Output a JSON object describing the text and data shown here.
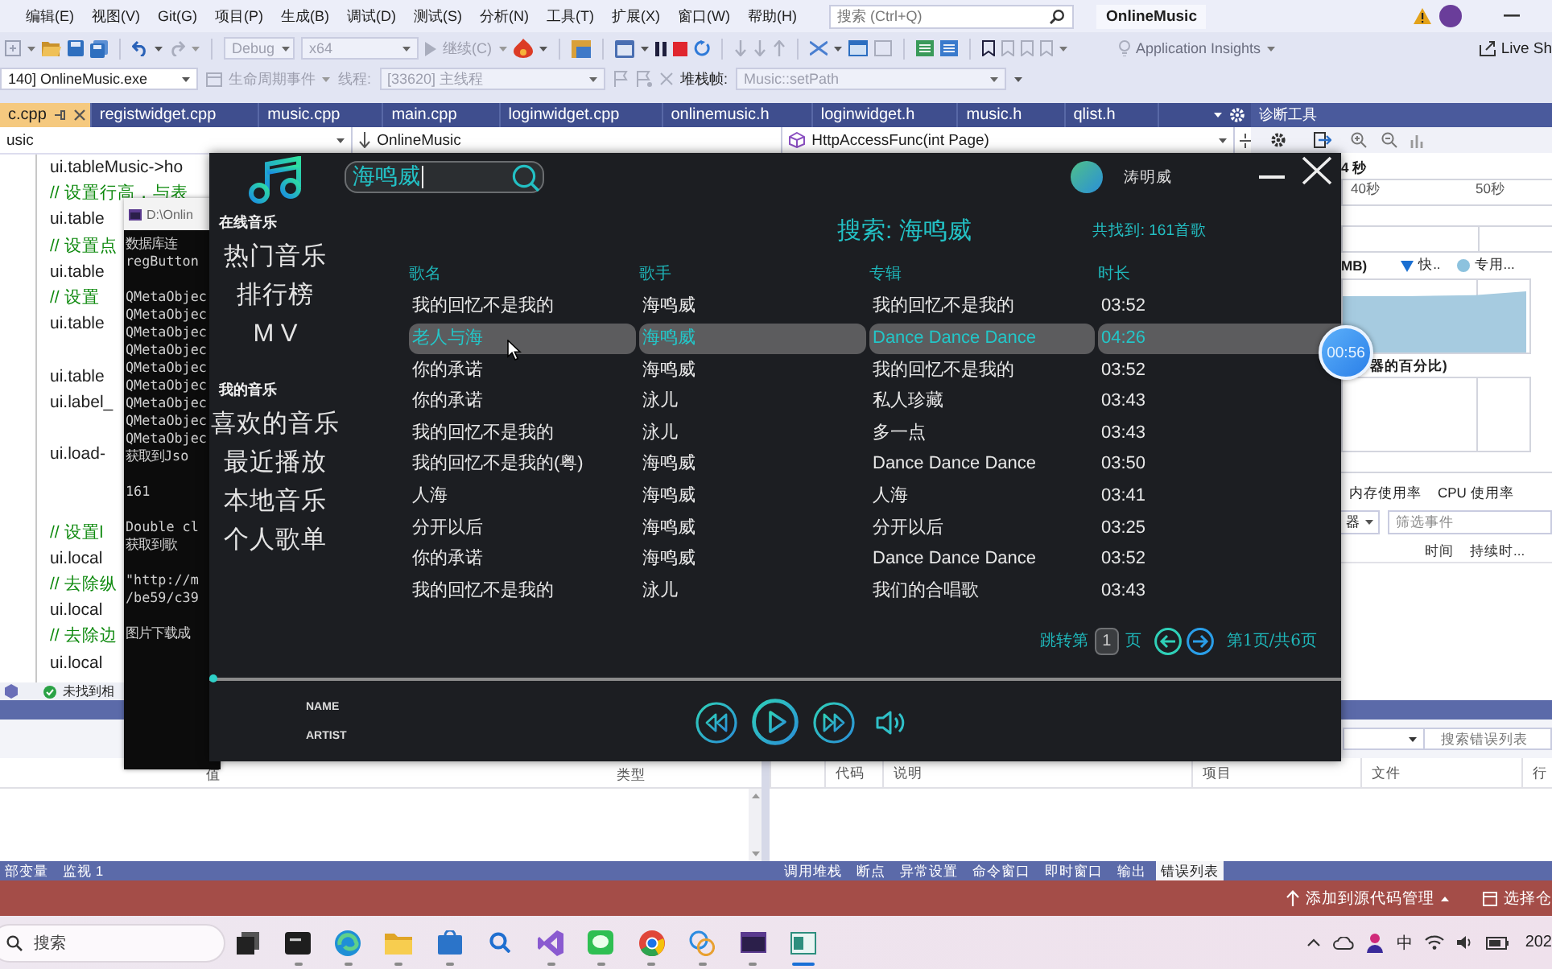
{
  "vs": {
    "menu": [
      "编辑(E)",
      "视图(V)",
      "Git(G)",
      "项目(P)",
      "生成(B)",
      "调试(D)",
      "测试(S)",
      "分析(N)",
      "工具(T)",
      "扩展(X)",
      "窗口(W)",
      "帮助(H)"
    ],
    "search": {
      "placeholder": "搜索 (Ctrl+Q)"
    },
    "solution": "OnlineMusic",
    "toolbar": {
      "configuration": {
        "label": "Debug",
        "disabled": true
      },
      "platform": {
        "label": "x64",
        "disabled": true
      },
      "continue": {
        "label": "继续(C)",
        "disabled": true
      },
      "insights": "Application Insights",
      "live_share": "Live Sh"
    },
    "debug_bar": {
      "process": "140] OnlineMusic.exe",
      "lifecycle": {
        "label": "生命周期事件",
        "disabled": true
      },
      "thread_label": "线程:",
      "thread": {
        "label": "[33620] 主线程",
        "disabled": true
      },
      "stack_label": "堆栈帧:",
      "stack_frame": {
        "label": "Music::setPath",
        "disabled": true
      }
    },
    "tabs": [
      {
        "label": "c.cpp",
        "selected": true
      },
      {
        "label": "registwidget.cpp",
        "selected": false
      },
      {
        "label": "music.cpp",
        "selected": false
      },
      {
        "label": "main.cpp",
        "selected": false
      },
      {
        "label": "loginwidget.cpp",
        "selected": false
      },
      {
        "label": "onlinemusic.h",
        "selected": false
      },
      {
        "label": "loginwidget.h",
        "selected": false
      },
      {
        "label": "music.h",
        "selected": false
      },
      {
        "label": "qlist.h",
        "selected": false
      }
    ],
    "nav_bar": {
      "scope": "usic",
      "type": "OnlineMusic",
      "member": "HttpAccessFunc(int Page)"
    },
    "code_lines": [
      {
        "kind": "code",
        "text": "ui.tableMusic->ho"
      },
      {
        "kind": "comment",
        "text": "// 设置行高，与表"
      },
      {
        "kind": "code",
        "text": "ui.table"
      },
      {
        "kind": "comment",
        "text": "// 设置点"
      },
      {
        "kind": "code",
        "text": "ui.table"
      },
      {
        "kind": "comment",
        "text": "//  设置"
      },
      {
        "kind": "code",
        "text": "ui.table"
      },
      {
        "kind": "blank"
      },
      {
        "kind": "code",
        "text": "ui.table"
      },
      {
        "kind": "code",
        "text": "ui.label_"
      },
      {
        "kind": "blank"
      },
      {
        "kind": "code",
        "text": "ui.load-"
      },
      {
        "kind": "blank"
      },
      {
        "kind": "blank"
      },
      {
        "kind": "comment",
        "text": "// 设置l"
      },
      {
        "kind": "code",
        "text": "ui.local"
      },
      {
        "kind": "comment",
        "text": "// 去除纵"
      },
      {
        "kind": "code",
        "text": "ui.local"
      },
      {
        "kind": "comment",
        "text": "// 去除边"
      },
      {
        "kind": "code",
        "text": "ui.local"
      }
    ],
    "status_line": "未找到相",
    "diagnostics": {
      "title": "诊断工具",
      "session": "4 秒",
      "ruler": [
        "40秒",
        "50秒"
      ],
      "memory_label": "MB)",
      "legend": [
        {
          "kind": "snapshot",
          "label": "快.."
        },
        {
          "kind": "private",
          "label": "专用..."
        }
      ],
      "cpu_label": "器的百分比)",
      "tabs": [
        "内存使用率",
        "CPU 使用率"
      ],
      "filter_dropdown": "器",
      "filter": {
        "placeholder": "筛选事件"
      },
      "columns": [
        "时间",
        "持续时..."
      ]
    },
    "bottom": {
      "left_columns": [
        "值",
        "类型"
      ],
      "right_search": {
        "placeholder": "搜索错误列表"
      },
      "right_columns": [
        "代码",
        "说明",
        "项目",
        "文件",
        "行"
      ],
      "left_tabs": [
        {
          "label": "部变量",
          "selected": false
        },
        {
          "label": "监视 1",
          "selected": false
        }
      ],
      "right_tabs": [
        {
          "label": "调用堆栈",
          "selected": false
        },
        {
          "label": "断点",
          "selected": false
        },
        {
          "label": "异常设置",
          "selected": false
        },
        {
          "label": "命令窗口",
          "selected": false
        },
        {
          "label": "即时窗口",
          "selected": false
        },
        {
          "label": "输出",
          "selected": false
        },
        {
          "label": "错误列表",
          "selected": true
        }
      ]
    },
    "status_bar": {
      "source_control": "添加到源代码管理",
      "repository": "选择仓"
    }
  },
  "console": {
    "title": "D:\\Onlin",
    "lines": [
      {
        "kind": "text",
        "text": "数据库连"
      },
      {
        "kind": "text",
        "text": "regButton"
      },
      {
        "kind": "blank"
      },
      {
        "kind": "text",
        "text": "QMetaObjec"
      },
      {
        "kind": "text",
        "text": "QMetaObjec"
      },
      {
        "kind": "text",
        "text": "QMetaObjec"
      },
      {
        "kind": "text",
        "text": "QMetaObjec"
      },
      {
        "kind": "text",
        "text": "QMetaObjec"
      },
      {
        "kind": "text",
        "text": "QMetaObjec"
      },
      {
        "kind": "text",
        "text": "QMetaObjec"
      },
      {
        "kind": "text",
        "text": "QMetaObjec"
      },
      {
        "kind": "text",
        "text": "QMetaObjec"
      },
      {
        "kind": "text",
        "text": "获取到Jso"
      },
      {
        "kind": "blank"
      },
      {
        "kind": "text",
        "text": "161"
      },
      {
        "kind": "blank"
      },
      {
        "kind": "text",
        "text": "Double cl"
      },
      {
        "kind": "text",
        "text": "获取到歌"
      },
      {
        "kind": "blank"
      },
      {
        "kind": "text",
        "text": "\"http://m"
      },
      {
        "kind": "text",
        "text": "/be59/c39"
      },
      {
        "kind": "blank"
      },
      {
        "kind": "text",
        "text": "图片下载成"
      }
    ]
  },
  "music_app": {
    "sidebar": {
      "sections": [
        {
          "title": "在线音乐",
          "items": [
            {
              "label": "热门音乐",
              "selected": false
            },
            {
              "label": "排行榜",
              "selected": false
            },
            {
              "label": "M V",
              "selected": false
            }
          ]
        },
        {
          "title": "我的音乐",
          "items": [
            {
              "label": "喜欢的音乐",
              "selected": false
            },
            {
              "label": "最近播放",
              "selected": false
            },
            {
              "label": "本地音乐",
              "selected": false
            },
            {
              "label": "个人歌单",
              "selected": false
            }
          ]
        }
      ]
    },
    "search": {
      "value": "海鸣威"
    },
    "user": {
      "name": "涛明威"
    },
    "heading": "搜索: 海鸣威",
    "count": "共找到: 161首歌",
    "table": {
      "columns": [
        "歌名",
        "歌手",
        "专辑",
        "时长"
      ],
      "rows": [
        {
          "cells": [
            "我的回忆不是我的",
            "海鸣威",
            "我的回忆不是我的",
            "03:52"
          ],
          "selected": false
        },
        {
          "cells": [
            "老人与海",
            "海鸣威",
            "Dance Dance Dance",
            "04:26"
          ],
          "selected": true
        },
        {
          "cells": [
            "你的承诺",
            "海鸣威",
            "我的回忆不是我的",
            "03:52"
          ],
          "selected": false
        },
        {
          "cells": [
            "你的承诺",
            "泳儿",
            "私人珍藏",
            "03:43"
          ],
          "selected": false
        },
        {
          "cells": [
            "我的回忆不是我的",
            "泳儿",
            "多一点",
            "03:43"
          ],
          "selected": false
        },
        {
          "cells": [
            "我的回忆不是我的(粤)",
            "海鸣威",
            "Dance Dance Dance",
            "03:50"
          ],
          "selected": false
        },
        {
          "cells": [
            "人海",
            "海鸣威",
            "人海",
            "03:41"
          ],
          "selected": false
        },
        {
          "cells": [
            "分开以后",
            "海鸣威",
            "分开以后",
            "03:25"
          ],
          "selected": false
        },
        {
          "cells": [
            "你的承诺",
            "海鸣威",
            "Dance Dance Dance",
            "03:52"
          ],
          "selected": false
        },
        {
          "cells": [
            "我的回忆不是我的",
            "泳儿",
            "我们的合唱歌",
            "03:43"
          ],
          "selected": false
        }
      ]
    },
    "pagination": {
      "prefix": "跳转第",
      "page": "1",
      "suffix": "页",
      "status": "第1页/共6页"
    },
    "progress": {
      "level": 0
    },
    "now_playing": {
      "name": "NAME",
      "artist": "ARTIST"
    },
    "timer": "00:56"
  },
  "taskbar": {
    "search": {
      "placeholder": "搜索"
    },
    "apps": [
      {
        "kind": "task-view",
        "running": false,
        "selected": false
      },
      {
        "kind": "terminal",
        "running": true,
        "selected": false
      },
      {
        "kind": "swirl",
        "running": true,
        "selected": false
      },
      {
        "kind": "folder",
        "running": true,
        "selected": false
      },
      {
        "kind": "store",
        "running": true,
        "selected": false
      },
      {
        "kind": "search",
        "running": false,
        "selected": false
      },
      {
        "kind": "ribbon",
        "running": true,
        "selected": false
      },
      {
        "kind": "chat",
        "running": true,
        "selected": false
      },
      {
        "kind": "round-browser",
        "running": true,
        "selected": false
      },
      {
        "kind": "bubbles",
        "running": true,
        "selected": false
      },
      {
        "kind": "console",
        "running": true,
        "selected": false
      },
      {
        "kind": "app-window",
        "running": true,
        "selected": true
      }
    ],
    "tray": {
      "ime": "中",
      "clock": "202"
    }
  }
}
